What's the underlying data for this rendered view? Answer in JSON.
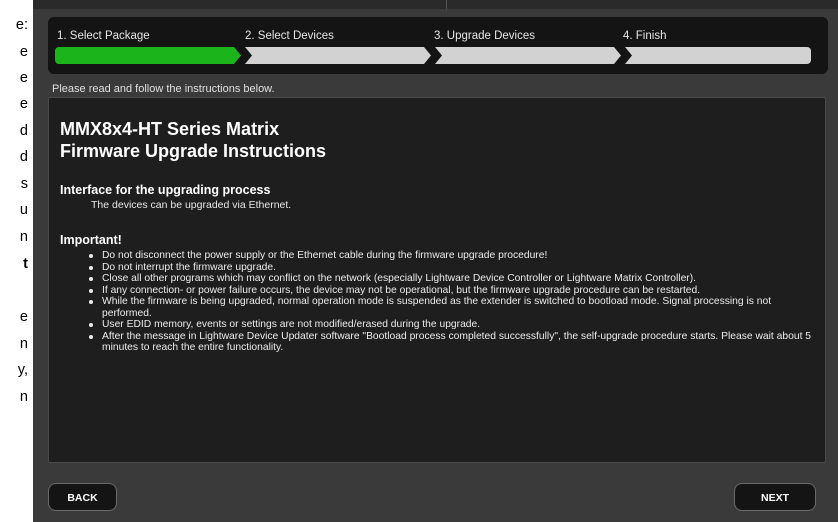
{
  "document_fragment": {
    "lines": [
      {
        "text": "e:",
        "bold": false
      },
      {
        "text": "e",
        "bold": false
      },
      {
        "text": "e",
        "bold": false
      },
      {
        "text": "e",
        "bold": false
      },
      {
        "text": "d",
        "bold": false
      },
      {
        "text": "d",
        "bold": false
      },
      {
        "text": "s",
        "bold": false
      },
      {
        "text": "u",
        "bold": false
      },
      {
        "text": "n",
        "bold": false
      },
      {
        "text": "t",
        "bold": true
      },
      {
        "text": "",
        "bold": false
      },
      {
        "text": "e",
        "bold": false
      },
      {
        "text": "n",
        "bold": false
      },
      {
        "text": "y,",
        "bold": false
      },
      {
        "text": "n",
        "bold": false
      }
    ]
  },
  "wizard": {
    "steps": [
      {
        "label": "1. Select Package",
        "active": true
      },
      {
        "label": "2. Select Devices",
        "active": false
      },
      {
        "label": "3. Upgrade Devices",
        "active": false
      },
      {
        "label": "4. Finish",
        "active": false
      }
    ],
    "colors": {
      "active": "#1bb41b",
      "inactive": "#d2d2d2"
    }
  },
  "instructions_label": "Please read and follow the instructions below.",
  "content": {
    "title_line1": "MMX8x4-HT Series Matrix",
    "title_line2": "Firmware Upgrade Instructions",
    "interface_heading": "Interface for the upgrading process",
    "interface_text": "The devices can be upgraded via Ethernet.",
    "important_heading": "Important!",
    "bullets": [
      "Do not disconnect the power supply or the Ethernet cable during the firmware upgrade procedure!",
      "Do not interrupt the firmware upgrade.",
      "Close all other programs which may conflict on the network (especially Lightware Device Controller or Lightware Matrix Controller).",
      "If any connection- or power failure occurs, the device may not be operational, but the firmware upgrade procedure can be restarted.",
      "While the firmware is being upgraded, normal operation mode is suspended as the extender is switched to bootload mode. Signal processing is not performed.",
      "User EDID memory, events or settings are not modified/erased during the upgrade.",
      "After the message in Lightware Device Updater software \"Bootload process completed successfully\", the self-upgrade procedure starts. Please wait about 5 minutes to reach the entire functionality."
    ]
  },
  "buttons": {
    "back": "BACK",
    "next": "NEXT"
  }
}
